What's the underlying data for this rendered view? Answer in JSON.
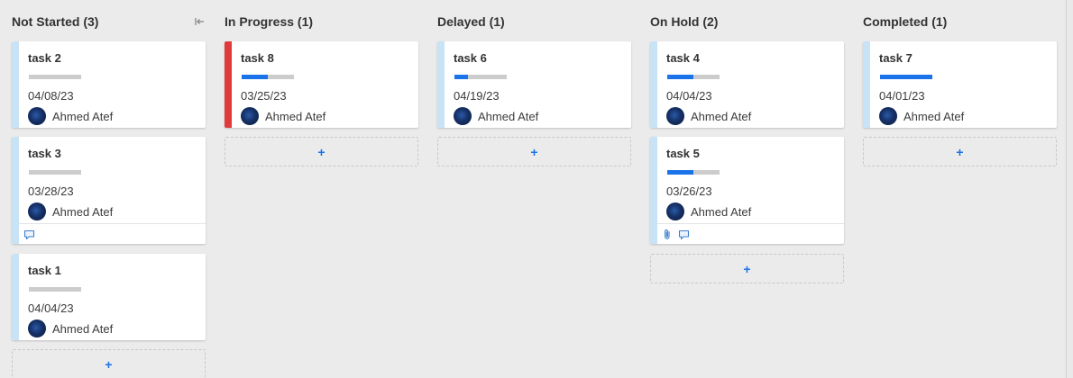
{
  "colors": {
    "stripe_default": "#c8e3f5",
    "stripe_red": "#e03a3a",
    "progress_fill": "#1a73e8",
    "progress_track": "#cccccc",
    "add_plus": "#1a73e8"
  },
  "columns": [
    {
      "title": "Not Started (3)",
      "collapse_icon": "collapse-left-icon",
      "add_label": "+",
      "cards": [
        {
          "title": "task 2",
          "progress": 0,
          "date": "04/08/23",
          "assignee": "Ahmed Atef",
          "stripe": "default",
          "footer_icons": []
        },
        {
          "title": "task 3",
          "progress": 0,
          "date": "03/28/23",
          "assignee": "Ahmed Atef",
          "stripe": "default",
          "footer_icons": [
            "comment-icon"
          ]
        },
        {
          "title": "task 1",
          "progress": 0,
          "date": "04/04/23",
          "assignee": "Ahmed Atef",
          "stripe": "default",
          "footer_icons": []
        }
      ]
    },
    {
      "title": "In Progress (1)",
      "add_label": "+",
      "cards": [
        {
          "title": "task 8",
          "progress": 0.5,
          "date": "03/25/23",
          "assignee": "Ahmed Atef",
          "stripe": "red",
          "footer_icons": []
        }
      ]
    },
    {
      "title": "Delayed (1)",
      "add_label": "+",
      "cards": [
        {
          "title": "task 6",
          "progress": 0.25,
          "date": "04/19/23",
          "assignee": "Ahmed Atef",
          "stripe": "default",
          "footer_icons": []
        }
      ]
    },
    {
      "title": "On Hold (2)",
      "add_label": "+",
      "cards": [
        {
          "title": "task 4",
          "progress": 0.5,
          "date": "04/04/23",
          "assignee": "Ahmed Atef",
          "stripe": "default",
          "footer_icons": []
        },
        {
          "title": "task 5",
          "progress": 0.5,
          "date": "03/26/23",
          "assignee": "Ahmed Atef",
          "stripe": "default",
          "footer_icons": [
            "attachment-icon",
            "comment-icon"
          ]
        }
      ]
    },
    {
      "title": "Completed (1)",
      "add_label": "+",
      "cards": [
        {
          "title": "task 7",
          "progress": 1,
          "date": "04/01/23",
          "assignee": "Ahmed Atef",
          "stripe": "default",
          "footer_icons": []
        }
      ]
    }
  ]
}
